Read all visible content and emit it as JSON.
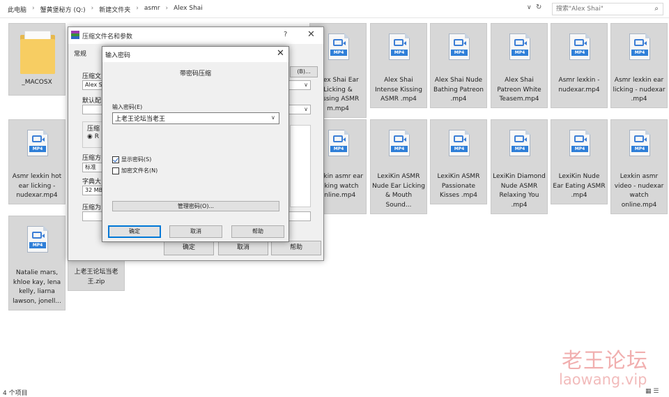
{
  "address_bar": {
    "breadcrumbs": [
      "此电脑",
      "蟹黄堡秘方 (Q:)",
      "新建文件夹",
      "asmr",
      "Alex Shai"
    ],
    "dropdown_glyph": "∨",
    "refresh_glyph": "↻",
    "search_placeholder": "搜索\"Alex Shai\"",
    "search_icon": "⌕"
  },
  "files": [
    {
      "kind": "folder",
      "label": "_MACOSX"
    },
    {
      "kind": "mp4",
      "icon_text": "MP4",
      "label": "Alex Shai Ear Licking & Kissing ASMR m.mp4"
    },
    {
      "kind": "mp4",
      "icon_text": "MP4",
      "label": "Alex Shai Intense Kissing ASMR .mp4"
    },
    {
      "kind": "mp4",
      "icon_text": "MP4",
      "label": "Alex Shai Nude Bathing Patreon .mp4"
    },
    {
      "kind": "mp4",
      "icon_text": "MP4",
      "label": "Alex Shai Patreon White Teasem.mp4"
    },
    {
      "kind": "mp4",
      "icon_text": "MP4",
      "label": "Asmr lexkin - nudexar.mp4"
    },
    {
      "kind": "mp4",
      "icon_text": "MP4",
      "label": "Asmr lexkin ear licking - nudexar .mp4"
    },
    {
      "kind": "mp4",
      "icon_text": "MP4",
      "label": "Asmr lexkin hot ear licking - nudexar.mp4"
    },
    {
      "kind": "mp4",
      "icon_text": "MP4",
      "label": "Lexkin asmr ear licking watch online.mp4"
    },
    {
      "kind": "mp4",
      "icon_text": "MP4",
      "label": "LexiKin ASMR Nude Ear Licking & Mouth Sound..."
    },
    {
      "kind": "mp4",
      "icon_text": "MP4",
      "label": "LexiKin ASMR Passionate Kisses .mp4"
    },
    {
      "kind": "mp4",
      "icon_text": "MP4",
      "label": "LexiKin Diamond Nude ASMR Relaxing You .mp4"
    },
    {
      "kind": "mp4",
      "icon_text": "MP4",
      "label": "LexiKin Nude Ear Eating ASMR .mp4"
    },
    {
      "kind": "mp4",
      "icon_text": "MP4",
      "label": "Lexkin asmr video - nudexar watch online.mp4"
    },
    {
      "kind": "mp4",
      "icon_text": "MP4",
      "label": "Natalie mars, khloe kay, lena kelly, liarna lawson, jonell..."
    },
    {
      "kind": "zip",
      "label": "上老王论坛当老王.zip"
    }
  ],
  "status_bar": {
    "count": "4 个项目",
    "view_icons": "▦ ☰"
  },
  "watermark": {
    "cn": "老王论坛",
    "en": "laowang.vip"
  },
  "rar_dialog": {
    "title": "压缩文件名和参数",
    "help_glyph": "?",
    "close_glyph": "✕",
    "tab": "常规",
    "label_archive_name": "压缩文",
    "archive_name_value": "Alex S",
    "browse_button": "(B)...",
    "label_default": "默认配",
    "label_format": "压缩",
    "radio_text": "R",
    "label_method": "压缩方",
    "method_value": "标准",
    "label_dict": "字典大",
    "dict_value": "32 MB",
    "label_split": "压缩为",
    "ok_button": "确定",
    "cancel_button": "取消",
    "help_button": "帮助"
  },
  "password_dialog": {
    "title": "输入密码",
    "close_glyph": "✕",
    "caption": "带密码压缩",
    "enter_label": "输入密码(E)",
    "password_value": "上老王论坛当老王",
    "dropdown_glyph": "∨",
    "show_password_label": "显示密码(S)",
    "show_password_checked": true,
    "encrypt_names_label": "加密文件名(N)",
    "encrypt_names_checked": false,
    "manage_button": "管理密码(O)...",
    "ok_button": "确定",
    "cancel_button": "取消",
    "help_button": "帮助"
  }
}
